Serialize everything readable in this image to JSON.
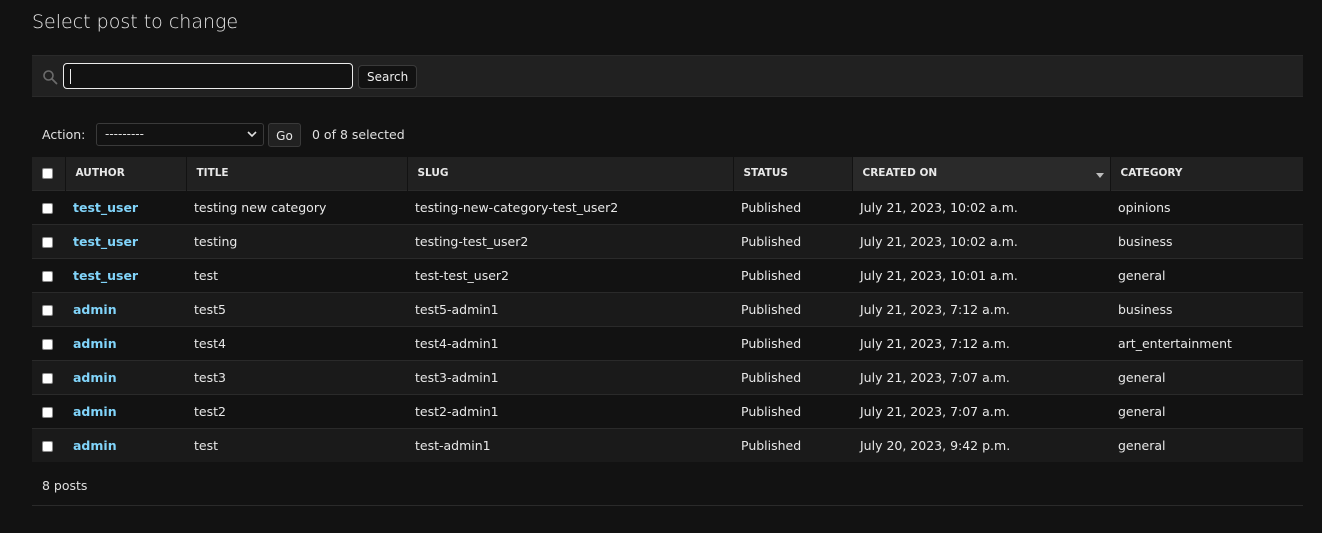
{
  "page": {
    "title": "Select post to change"
  },
  "search": {
    "value": "",
    "button_label": "Search"
  },
  "actions": {
    "label": "Action:",
    "selected_option": "---------",
    "go_label": "Go",
    "selected_count": "0 of 8 selected"
  },
  "table": {
    "columns": [
      "Author",
      "Title",
      "Slug",
      "Status",
      "Created on",
      "Category"
    ],
    "sorted_column": "Created on",
    "rows": [
      {
        "author": "test_user",
        "title": "testing new category",
        "slug": "testing-new-category-test_user2",
        "status": "Published",
        "created_on": "July 21, 2023, 10:02 a.m.",
        "category": "opinions"
      },
      {
        "author": "test_user",
        "title": "testing",
        "slug": "testing-test_user2",
        "status": "Published",
        "created_on": "July 21, 2023, 10:02 a.m.",
        "category": "business"
      },
      {
        "author": "test_user",
        "title": "test",
        "slug": "test-test_user2",
        "status": "Published",
        "created_on": "July 21, 2023, 10:01 a.m.",
        "category": "general"
      },
      {
        "author": "admin",
        "title": "test5",
        "slug": "test5-admin1",
        "status": "Published",
        "created_on": "July 21, 2023, 7:12 a.m.",
        "category": "business"
      },
      {
        "author": "admin",
        "title": "test4",
        "slug": "test4-admin1",
        "status": "Published",
        "created_on": "July 21, 2023, 7:12 a.m.",
        "category": "art_entertainment"
      },
      {
        "author": "admin",
        "title": "test3",
        "slug": "test3-admin1",
        "status": "Published",
        "created_on": "July 21, 2023, 7:07 a.m.",
        "category": "general"
      },
      {
        "author": "admin",
        "title": "test2",
        "slug": "test2-admin1",
        "status": "Published",
        "created_on": "July 21, 2023, 7:07 a.m.",
        "category": "general"
      },
      {
        "author": "admin",
        "title": "test",
        "slug": "test-admin1",
        "status": "Published",
        "created_on": "July 20, 2023, 9:42 p.m.",
        "category": "general"
      }
    ]
  },
  "paginator": {
    "count_label": "8 posts"
  },
  "colors": {
    "background": "#121212",
    "link": "#81d4fa",
    "header_bg": "#212121"
  }
}
